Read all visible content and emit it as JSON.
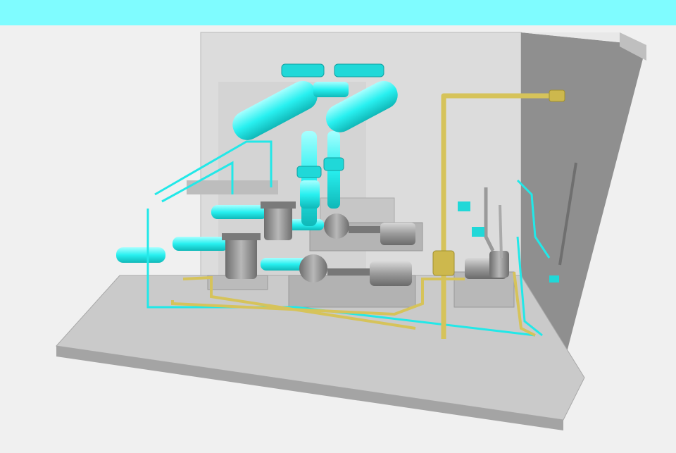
{
  "colors": {
    "header_bar": "#7ffcff",
    "background": "#f0f0f0",
    "floor": "#c9c9c9",
    "wall": "#d8d8d8",
    "side_wall": "#9a9a9a",
    "cyan_pipe": "#28f0f0",
    "yellow_pipe": "#d8c860",
    "equipment_gray": "#8c8c8c"
  },
  "scene": {
    "description_icon": "3d-piping-model",
    "objects": [
      "pump-skid-front",
      "pump-skid-rear",
      "strainer-left",
      "strainer-right",
      "cyan-header-pipe-left",
      "cyan-header-pipe-right",
      "yellow-steam-line",
      "right-wall-pumps"
    ]
  }
}
